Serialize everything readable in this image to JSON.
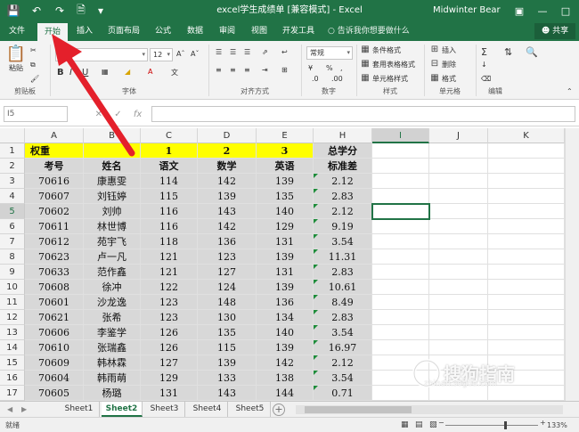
{
  "window": {
    "title": "excel学生成绩单 [兼容模式] - Excel",
    "user": "Midwinter Bear"
  },
  "colors": {
    "accent": "#217346",
    "highlight": "#ffff00",
    "grey": "#d8d8d8",
    "arrow": "#e4202b"
  },
  "tabs": [
    "文件",
    "开始",
    "插入",
    "页面布局",
    "公式",
    "数据",
    "审阅",
    "视图",
    "开发工具"
  ],
  "active_tab": "开始",
  "tell_me": "告诉我你想要做什么",
  "share": "共享",
  "ribbon": {
    "groups": [
      "剪贴板",
      "字体",
      "对齐方式",
      "数字",
      "样式",
      "单元格",
      "编辑"
    ],
    "paste_label": "粘贴",
    "font_size": "12",
    "number_format": "常规",
    "style_items": [
      "条件格式",
      "套用表格格式",
      "单元格样式"
    ],
    "cell_items": [
      "插入",
      "删除",
      "格式"
    ]
  },
  "formula_bar": {
    "name_box": "I5",
    "formula": ""
  },
  "columns": [
    "A",
    "B",
    "C",
    "D",
    "E",
    "H",
    "I",
    "J",
    "K"
  ],
  "selected_column": "I",
  "rows": [
    {
      "n": "1",
      "cells": [
        "权重",
        "",
        "1",
        "2",
        "3",
        "总学分"
      ]
    },
    {
      "n": "2",
      "cells": [
        "考号",
        "姓名",
        "语文",
        "数学",
        "英语",
        "标准差"
      ]
    },
    {
      "n": "3",
      "cells": [
        "70616",
        "康惠雯",
        "114",
        "142",
        "139",
        "2.12"
      ]
    },
    {
      "n": "4",
      "cells": [
        "70607",
        "刘钰婷",
        "115",
        "139",
        "135",
        "2.83"
      ]
    },
    {
      "n": "5",
      "cells": [
        "70602",
        "刘帅",
        "116",
        "143",
        "140",
        "2.12"
      ]
    },
    {
      "n": "6",
      "cells": [
        "70611",
        "林世博",
        "116",
        "142",
        "129",
        "9.19"
      ]
    },
    {
      "n": "7",
      "cells": [
        "70612",
        "苑宇飞",
        "118",
        "136",
        "131",
        "3.54"
      ]
    },
    {
      "n": "8",
      "cells": [
        "70623",
        "卢一凡",
        "121",
        "123",
        "139",
        "11.31"
      ]
    },
    {
      "n": "9",
      "cells": [
        "70633",
        "范作鑫",
        "121",
        "127",
        "131",
        "2.83"
      ]
    },
    {
      "n": "10",
      "cells": [
        "70608",
        "徐冲",
        "122",
        "124",
        "139",
        "10.61"
      ]
    },
    {
      "n": "11",
      "cells": [
        "70601",
        "沙龙逸",
        "123",
        "148",
        "136",
        "8.49"
      ]
    },
    {
      "n": "12",
      "cells": [
        "70621",
        "张希",
        "123",
        "130",
        "134",
        "2.83"
      ]
    },
    {
      "n": "13",
      "cells": [
        "70606",
        "李鉴学",
        "126",
        "135",
        "140",
        "3.54"
      ]
    },
    {
      "n": "14",
      "cells": [
        "70610",
        "张瑞鑫",
        "126",
        "115",
        "139",
        "16.97"
      ]
    },
    {
      "n": "15",
      "cells": [
        "70609",
        "韩林霖",
        "127",
        "139",
        "142",
        "2.12"
      ]
    },
    {
      "n": "16",
      "cells": [
        "70604",
        "韩雨萌",
        "129",
        "133",
        "138",
        "3.54"
      ]
    },
    {
      "n": "17",
      "cells": [
        "70605",
        "杨璐",
        "131",
        "143",
        "144",
        "0.71"
      ]
    }
  ],
  "selected_row": "5",
  "sheets": [
    "Sheet1",
    "Sheet2",
    "Sheet3",
    "Sheet4",
    "Sheet5"
  ],
  "active_sheet": "Sheet2",
  "status": {
    "text": "就绪",
    "zoom": "133%"
  },
  "watermark": {
    "brand": "搜狗指南",
    "url": "zhinan.sogou.com"
  }
}
